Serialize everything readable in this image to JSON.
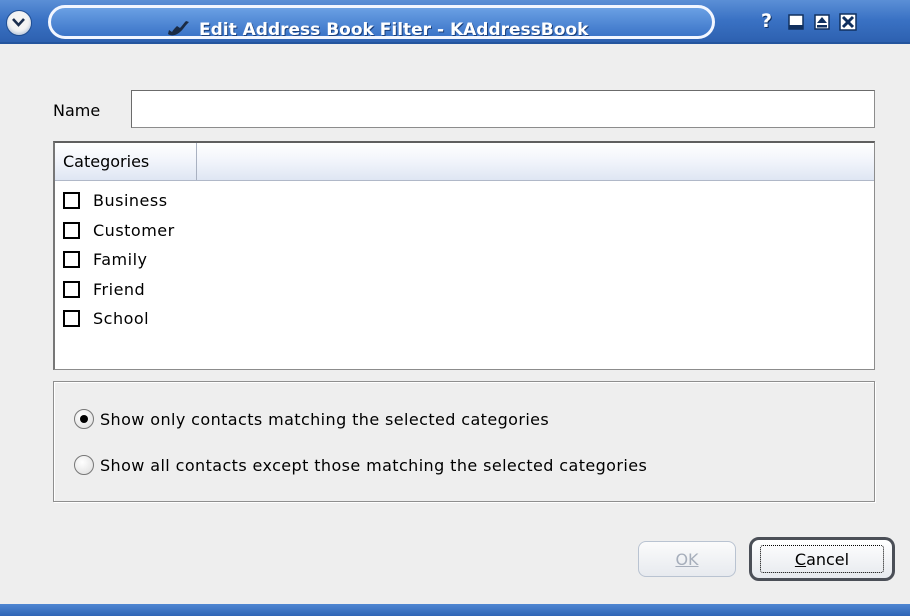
{
  "window": {
    "title": "Edit Address Book Filter - KAddressBook",
    "help_glyph": "?"
  },
  "form": {
    "name_label": "Name",
    "name_value": ""
  },
  "categories": {
    "header": "Categories",
    "items": [
      {
        "label": "Business",
        "checked": false
      },
      {
        "label": "Customer",
        "checked": false
      },
      {
        "label": "Family",
        "checked": false
      },
      {
        "label": "Friend",
        "checked": false
      },
      {
        "label": "School",
        "checked": false
      }
    ]
  },
  "match_options": [
    {
      "label": "Show only contacts matching the selected categories",
      "selected": true
    },
    {
      "label": "Show all contacts except those matching the selected categories",
      "selected": false
    }
  ],
  "buttons": {
    "ok_label": "OK",
    "ok_enabled": false,
    "cancel_label": "Cancel"
  },
  "colors": {
    "titlebar": "#3a72c4",
    "window_bg": "#eeeeee",
    "header_bg": "#dfe6f3"
  }
}
